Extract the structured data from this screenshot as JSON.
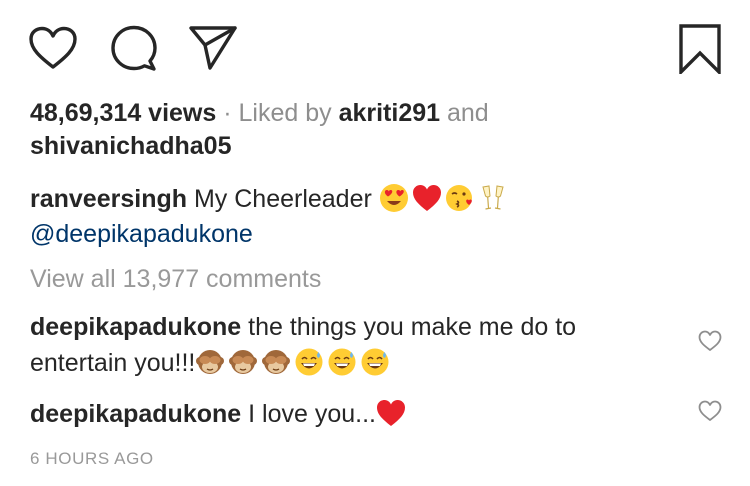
{
  "post": {
    "views_count": "48,69,314 views",
    "separator": " · ",
    "liked_by_prefix": "Liked by ",
    "liked_by_user": "akriti291",
    "liked_by_and": " and",
    "liked_by_user2": "shivanichadha05"
  },
  "caption": {
    "username": "ranveersingh",
    "text": " My Cheerleader ",
    "mention": "@deepikapadukone",
    "emojis": [
      "heart-eyes-emoji",
      "red-heart-emoji",
      "kissing-heart-emoji",
      "champagne-glasses-emoji"
    ]
  },
  "comments_link": "View all 13,977 comments",
  "comments": [
    {
      "username": "deepikapadukone",
      "text_line1": " the things you make me do to",
      "text_line2": "entertain you!!!",
      "emojis": [
        "see-no-evil-monkey-emoji",
        "see-no-evil-monkey-emoji",
        "see-no-evil-monkey-emoji",
        "grinning-sweat-emoji",
        "grinning-sweat-emoji",
        "grinning-sweat-emoji"
      ]
    },
    {
      "username": "deepikapadukone",
      "text": " I love you...",
      "emojis": [
        "red-heart-emoji"
      ]
    }
  ],
  "timestamp": "6 HOURS AGO",
  "icons": {
    "like": "heart-outline-icon",
    "comment": "comment-bubble-icon",
    "share": "paper-plane-icon",
    "save": "bookmark-icon",
    "comment_like": "heart-outline-icon"
  },
  "colors": {
    "text": "#262626",
    "muted": "#8e8e8e",
    "mention": "#003569",
    "heart": "#e8222b"
  }
}
